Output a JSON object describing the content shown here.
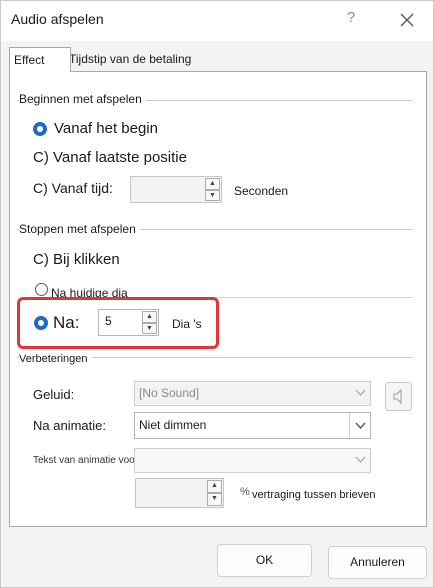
{
  "dialog": {
    "title": "Audio afspelen",
    "help": "?",
    "close": "close"
  },
  "tabs": [
    {
      "label": "Effect",
      "active": true
    },
    {
      "label": "Tijdstip van de betaling",
      "active": false
    }
  ],
  "start_group": {
    "label": "Beginnen met afspelen",
    "opt_begin": "Vanaf het begin",
    "opt_last": "C) Vanaf laatste positie",
    "opt_time": "C) Vanaf tijd:",
    "time_value": "",
    "seconds_label": "Seconden"
  },
  "stop_group": {
    "label": "Stoppen met afspelen",
    "opt_click": "C) Bij klikken",
    "opt_current": "Na huidige dia",
    "opt_after": "Na:",
    "after_value": "5",
    "slides_label": "Dia 's"
  },
  "enhance_group": {
    "label": "Verbeteringen",
    "sound_label": "Geluid:",
    "sound_value": "[No Sound]",
    "after_anim_label": "Na animatie:",
    "after_anim_value": "Niet dimmen",
    "animate_text_label": "Tekst van animatie voorzien:",
    "delay_value": "",
    "delay_suffix": "vertraging tussen brieven",
    "percent": "%"
  },
  "buttons": {
    "ok": "OK",
    "cancel": "Annuleren"
  },
  "colors": {
    "accent": "#1f6bc4",
    "highlight": "#e0363b"
  }
}
